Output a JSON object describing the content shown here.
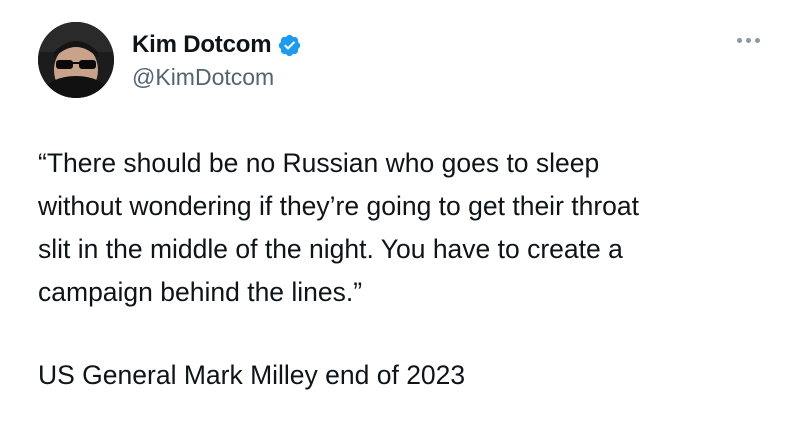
{
  "author": {
    "name": "Kim Dotcom",
    "handle": "@KimDotcom",
    "verified": true,
    "verified_color": "#1d9bf0"
  },
  "menu": {
    "icon": "more-horizontal-icon"
  },
  "tweet": {
    "quote": "“There should be no Russian who goes to sleep\nwithout wondering if they’re going to get their throat\nslit in the middle of the night. You have to create a\ncampaign behind the lines.”",
    "attribution": "US General Mark Milley end of 2023"
  }
}
